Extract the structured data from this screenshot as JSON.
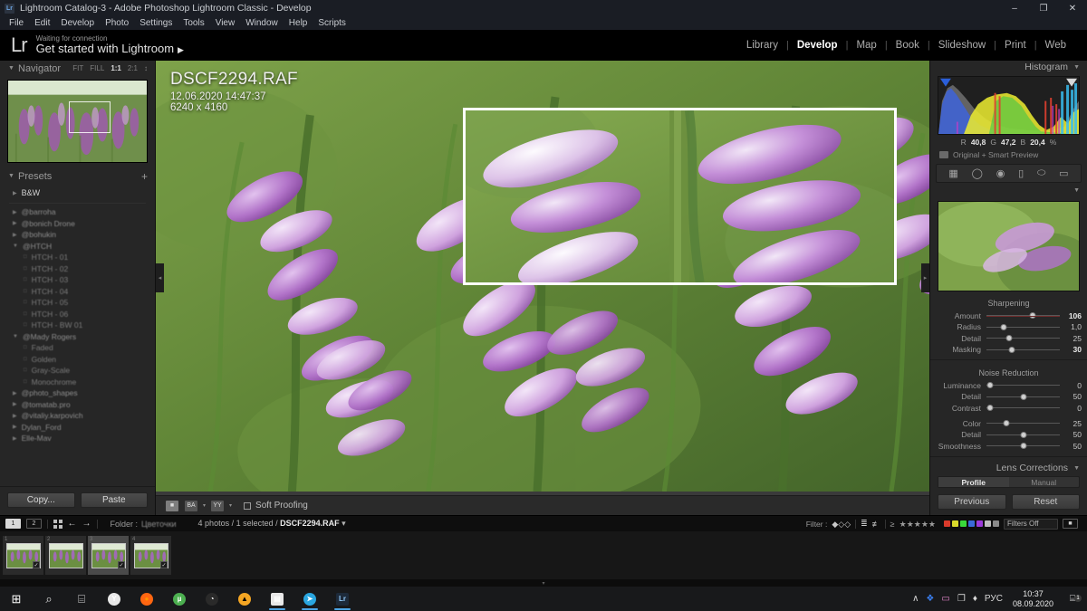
{
  "window": {
    "title": "Lightroom Catalog-3 - Adobe Photoshop Lightroom Classic - Develop",
    "app_badge": "Lr",
    "minimize": "–",
    "maximize": "❐",
    "close": "✕"
  },
  "menu": [
    "File",
    "Edit",
    "Develop",
    "Photo",
    "Settings",
    "Tools",
    "View",
    "Window",
    "Help",
    "Scripts"
  ],
  "identity": {
    "logo": "Lr",
    "status_small": "Waiting for connection",
    "status_main": "Get started with Lightroom",
    "status_arrow": "▶"
  },
  "modules": [
    {
      "label": "Library",
      "active": false
    },
    {
      "label": "Develop",
      "active": true
    },
    {
      "label": "Map",
      "active": false
    },
    {
      "label": "Book",
      "active": false
    },
    {
      "label": "Slideshow",
      "active": false
    },
    {
      "label": "Print",
      "active": false
    },
    {
      "label": "Web",
      "active": false
    }
  ],
  "navigator": {
    "title": "Navigator",
    "twisty": "▼",
    "zoom_levels": [
      "FIT",
      "FILL",
      "1:1",
      "2:1"
    ],
    "active_zoom": "1:1",
    "stepper": "↕"
  },
  "presets": {
    "title": "Presets",
    "twisty": "▼",
    "add": "+",
    "groups": [
      {
        "label": "B&W",
        "level": 0,
        "icon": "▶",
        "blur": false
      },
      {
        "label": "@barroha",
        "level": 0,
        "icon": "▶",
        "blur": true
      },
      {
        "label": "@bonich Drone",
        "level": 0,
        "icon": "▶",
        "blur": true
      },
      {
        "label": "@bohukin",
        "level": 0,
        "icon": "▶",
        "blur": true
      },
      {
        "label": "@HTCH",
        "level": 0,
        "icon": "▼",
        "blur": true
      },
      {
        "label": "HTCH - 01",
        "level": 1,
        "icon": "□",
        "blur": true
      },
      {
        "label": "HTCH - 02",
        "level": 1,
        "icon": "□",
        "blur": true
      },
      {
        "label": "HTCH - 03",
        "level": 1,
        "icon": "□",
        "blur": true
      },
      {
        "label": "HTCH - 04",
        "level": 1,
        "icon": "□",
        "blur": true
      },
      {
        "label": "HTCH - 05",
        "level": 1,
        "icon": "□",
        "blur": true
      },
      {
        "label": "HTCH - 06",
        "level": 1,
        "icon": "□",
        "blur": true
      },
      {
        "label": "HTCH - BW 01",
        "level": 1,
        "icon": "□",
        "blur": true
      },
      {
        "label": "@Mady Rogers",
        "level": 0,
        "icon": "▼",
        "blur": true
      },
      {
        "label": "Faded",
        "level": 1,
        "icon": "□",
        "blur": true
      },
      {
        "label": "Golden",
        "level": 1,
        "icon": "□",
        "blur": true
      },
      {
        "label": "Gray-Scale",
        "level": 1,
        "icon": "□",
        "blur": true
      },
      {
        "label": "Monochrome",
        "level": 1,
        "icon": "□",
        "blur": true
      },
      {
        "label": "@photo_shapes",
        "level": 0,
        "icon": "▶",
        "blur": true
      },
      {
        "label": "@tomatab.pro",
        "level": 0,
        "icon": "▶",
        "blur": true
      },
      {
        "label": "@vitaliy.karpovich",
        "level": 0,
        "icon": "▶",
        "blur": true
      },
      {
        "label": "Dylan_Ford",
        "level": 0,
        "icon": "▶",
        "blur": true
      },
      {
        "label": "Elle-Mav",
        "level": 0,
        "icon": "▶",
        "blur": true
      }
    ]
  },
  "left_buttons": {
    "copy": "Copy...",
    "paste": "Paste"
  },
  "image_info": {
    "filename": "DSCF2294.RAF",
    "datetime": "12.06.2020 14:47:37",
    "dimensions": "6240 x 4160"
  },
  "toolbar": {
    "loupe_icon": "■",
    "before_after": "BA",
    "before_after_2": "YY",
    "caret": "▾",
    "soft_proofing": "Soft Proofing"
  },
  "histogram": {
    "title": "Histogram",
    "twisty": "▼",
    "r_label": "R",
    "r_value": "40,8",
    "g_label": "G",
    "g_value": "47,2",
    "b_label": "B",
    "b_value": "20,4",
    "unit": "%",
    "preview_status": "Original + Smart Preview"
  },
  "tool_strip": [
    "▦",
    "◯",
    "◉",
    "▯",
    "⬭",
    "▭"
  ],
  "detail": {
    "twisty": "▼",
    "sharpening_title": "Sharpening",
    "sharpening": [
      {
        "label": "Amount",
        "value": "106",
        "pos": 63,
        "bold": true,
        "red": true
      },
      {
        "label": "Radius",
        "value": "1,0",
        "pos": 24,
        "bold": false,
        "red": false
      },
      {
        "label": "Detail",
        "value": "25",
        "pos": 31,
        "bold": false,
        "red": false
      },
      {
        "label": "Masking",
        "value": "30",
        "pos": 35,
        "bold": true,
        "red": false
      }
    ],
    "noise_title": "Noise Reduction",
    "noise": [
      {
        "label": "Luminance",
        "value": "0",
        "pos": 5,
        "bold": false,
        "red": false
      },
      {
        "label": "Detail",
        "value": "50",
        "pos": 50,
        "bold": false,
        "red": false
      },
      {
        "label": "Contrast",
        "value": "0",
        "pos": 5,
        "bold": false,
        "red": false
      }
    ],
    "color": [
      {
        "label": "Color",
        "value": "25",
        "pos": 27,
        "bold": false,
        "red": false
      },
      {
        "label": "Detail",
        "value": "50",
        "pos": 50,
        "bold": false,
        "red": false
      },
      {
        "label": "Smoothness",
        "value": "50",
        "pos": 50,
        "bold": false,
        "red": false
      }
    ]
  },
  "lens": {
    "title": "Lens Corrections",
    "twisty": "▼",
    "tabs": [
      {
        "label": "Profile",
        "active": true
      },
      {
        "label": "Manual",
        "active": false
      }
    ]
  },
  "right_buttons": {
    "previous": "Previous",
    "reset": "Reset"
  },
  "filmstrip": {
    "view1": "1",
    "view2": "2",
    "back_arrow": "←",
    "fwd_arrow": "→",
    "folder_label": "Folder :",
    "folder_name": "Цветочки",
    "count_text": "4 photos / 1 selected /",
    "selected_file": "DSCF2294.RAF",
    "caret": "▾",
    "filter_label": "Filter :",
    "flags": [
      "◆",
      "◇",
      "◇"
    ],
    "stars": [
      "★",
      "★",
      "★",
      "★",
      "★"
    ],
    "star_prefix": "≥",
    "color_labels": [
      "#d93a2b",
      "#d9d92b",
      "#3ad93a",
      "#3a6ad9",
      "#9b3ad9",
      "#bdbdbd",
      "#8a8a8a"
    ],
    "filter_select": "Filters Off",
    "thumbs": [
      {
        "num": "1",
        "selected": false,
        "badge": "✓"
      },
      {
        "num": "2",
        "selected": false,
        "badge": ""
      },
      {
        "num": "3",
        "selected": true,
        "badge": "✓"
      },
      {
        "num": "4",
        "selected": false,
        "badge": "✓"
      }
    ]
  },
  "taskbar": {
    "icons": [
      {
        "name": "start-icon",
        "glyph": "⊞",
        "color": "#ffffff",
        "bg": "none",
        "active": false
      },
      {
        "name": "search-icon",
        "glyph": "⌕",
        "color": "#e0e0e0",
        "bg": "none",
        "active": false
      },
      {
        "name": "task-view-icon",
        "glyph": "⌸",
        "color": "#e0e0e0",
        "bg": "none",
        "active": false
      },
      {
        "name": "yandex-browser-icon",
        "glyph": "Y",
        "color": "#ffffff",
        "bg": "#e8e8e8",
        "active": false
      },
      {
        "name": "firefox-icon",
        "glyph": "●",
        "color": "#ff9500",
        "bg": "#ff6611",
        "active": false
      },
      {
        "name": "utorrent-icon",
        "glyph": "µ",
        "color": "#ffffff",
        "bg": "#4caf50",
        "active": false
      },
      {
        "name": "obs-studio-icon",
        "glyph": "◔",
        "color": "#ffffff",
        "bg": "#2a2a2a",
        "active": false
      },
      {
        "name": "amd-icon",
        "glyph": "▲",
        "color": "#000000",
        "bg": "#f5a623",
        "active": false
      },
      {
        "name": "disk-save-icon",
        "glyph": "▤",
        "color": "#ffffff",
        "bg": "#e8e8e8",
        "active": true
      },
      {
        "name": "telegram-icon",
        "glyph": "➤",
        "color": "#ffffff",
        "bg": "#2aa6e0",
        "active": true
      },
      {
        "name": "lightroom-icon",
        "glyph": "Lr",
        "color": "#8fc7f5",
        "bg": "#1d2a3a",
        "active": true
      }
    ],
    "tray": {
      "chevron": "∧",
      "dropbox": "❖",
      "display": "▭",
      "network": "❐",
      "volume": "♦",
      "language": "РУС",
      "time": "10:37",
      "date": "08.09.2020",
      "notification": "⌸",
      "notification_count": "1"
    }
  }
}
